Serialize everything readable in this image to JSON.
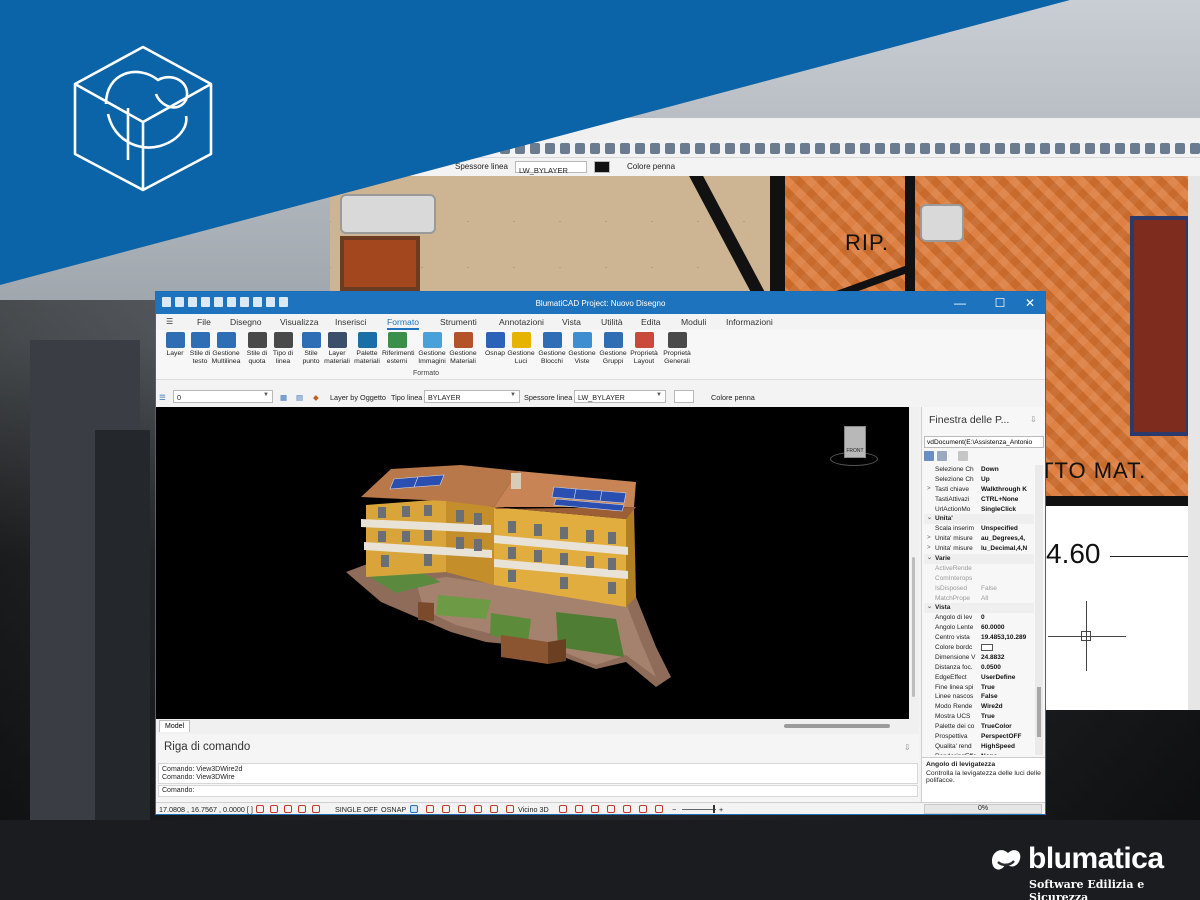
{
  "main_window": {
    "title": "BlumatiCAD Project: Nuovo Disegno",
    "controls": {
      "minimize": "—",
      "maximize": "☐",
      "close": "✕"
    }
  },
  "menu": {
    "items": [
      "File",
      "Disegno",
      "Visualizza",
      "Inserisci",
      "Formato",
      "Strumenti",
      "Annotazioni",
      "Vista",
      "Utilità",
      "Edita",
      "Moduli",
      "Informazioni"
    ],
    "active": "Formato"
  },
  "ribbon": {
    "group_label": "Formato",
    "buttons": [
      {
        "line1": "Layer",
        "line2": "",
        "icon": "layers-icon",
        "color": "#2f6db5"
      },
      {
        "line1": "Stile di",
        "line2": "testo",
        "icon": "text-style-icon",
        "color": "#2f6db5"
      },
      {
        "line1": "Gestione",
        "line2": "Multilinea",
        "icon": "multiline-icon",
        "color": "#2f6db5"
      },
      {
        "line1": "Stile di",
        "line2": "quota",
        "icon": "dimension-style-icon",
        "color": "#4a4a4a"
      },
      {
        "line1": "Tipo di",
        "line2": "linea",
        "icon": "linetype-icon",
        "color": "#4a4a4a"
      },
      {
        "line1": "Stile",
        "line2": "punto",
        "icon": "point-style-icon",
        "color": "#2f6db5"
      },
      {
        "line1": "Layer",
        "line2": "materiali",
        "icon": "layer-materials-icon",
        "color": "#3b4f6b"
      },
      {
        "line1": "Palette",
        "line2": "materiali",
        "icon": "palette-icon",
        "color": "#1b6fa8"
      },
      {
        "line1": "Riferimenti",
        "line2": "esterni",
        "icon": "xref-icon",
        "color": "#3a8f4a"
      },
      {
        "line1": "Gestione",
        "line2": "Immagini",
        "icon": "image-icon",
        "color": "#4aa0d8"
      },
      {
        "line1": "Gestione",
        "line2": "Materiali",
        "icon": "materials-icon",
        "color": "#b4532a"
      },
      {
        "line1": "Osnap",
        "line2": "",
        "icon": "magnet-icon",
        "color": "#2b63b8"
      },
      {
        "line1": "Gestione",
        "line2": "Luci",
        "icon": "bulb-icon",
        "color": "#e6b400"
      },
      {
        "line1": "Gestione",
        "line2": "Blocchi",
        "icon": "blocks-icon",
        "color": "#2f6db5"
      },
      {
        "line1": "Gestione",
        "line2": "Viste",
        "icon": "views-icon",
        "color": "#3f8fd0"
      },
      {
        "line1": "Gestione",
        "line2": "Gruppi",
        "icon": "groups-icon",
        "color": "#2f6db5"
      },
      {
        "line1": "Proprietà",
        "line2": "Layout",
        "icon": "layout-icon",
        "color": "#c94a3b"
      },
      {
        "line1": "Proprietà",
        "line2": "Generali",
        "icon": "general-props-icon",
        "color": "#4a4a4a"
      }
    ]
  },
  "propbar": {
    "layer_value": "0",
    "layer_by_object": "Layer by Oggetto",
    "linetype_label": "Tipo linea",
    "linetype_value": "BYLAYER",
    "lineweight_label": "Spessore linea",
    "lineweight_value": "LW_BYLAYER",
    "pen_color_label": "Colore penna"
  },
  "viewport": {
    "viewcube_label": "FRONT",
    "tab_label": "Model"
  },
  "command": {
    "title": "Riga di comando",
    "history": [
      "Comando: View3DWire2d",
      "Comando: View3DWire"
    ],
    "prompt": "Comando:"
  },
  "status": {
    "coords": "17.0808 , 16.7567 , 0.0000 [ ]",
    "single_off": "SINGLE OFF",
    "osnap": "OSNAP",
    "vicino3d": "Vicino 3D",
    "progress": "0%",
    "progress_fraction": 0,
    "zoom_fraction": 0.9
  },
  "properties": {
    "title": "Finestra delle P...",
    "pin": "⇩",
    "document": "vdDocument(E:\\Assistenza_Antonio",
    "rows": [
      {
        "t": "p",
        "k": "Selezione Ch",
        "v": "Down"
      },
      {
        "t": "p",
        "k": "Selezione Ch",
        "v": "Up"
      },
      {
        "t": "p",
        "k": "Tasti chiave",
        "v": "Walkthrough K",
        "x": ">"
      },
      {
        "t": "p",
        "k": "TastiAttivazi",
        "v": "CTRL+None"
      },
      {
        "t": "p",
        "k": "UrlActionMo",
        "v": "SingleClick"
      },
      {
        "t": "c",
        "k": "Unita'",
        "x": "⌄"
      },
      {
        "t": "p",
        "k": "Scala inserim",
        "v": "Unspecified"
      },
      {
        "t": "p",
        "k": "Unita' misure",
        "v": "au_Degrees,4,",
        "x": ">"
      },
      {
        "t": "p",
        "k": "Unita' misure",
        "v": "lu_Decimal,4,N",
        "x": ">"
      },
      {
        "t": "c",
        "k": "Varie",
        "x": "⌄"
      },
      {
        "t": "d",
        "k": "ActiveRende",
        "v": ""
      },
      {
        "t": "d",
        "k": "ComInterops",
        "v": ""
      },
      {
        "t": "d",
        "k": "IsDisposed",
        "v": "False"
      },
      {
        "t": "d",
        "k": "MatchPrope",
        "v": "All"
      },
      {
        "t": "c",
        "k": "Vista",
        "x": "⌄"
      },
      {
        "t": "p",
        "k": "Angolo di lev",
        "v": "0"
      },
      {
        "t": "p",
        "k": "Angolo Lente",
        "v": "60.0000"
      },
      {
        "t": "p",
        "k": "Centro vista",
        "v": "19.4853,10.289"
      },
      {
        "t": "s",
        "k": "Colore bordc",
        "v": ""
      },
      {
        "t": "p",
        "k": "Dimensione V",
        "v": "24.8832"
      },
      {
        "t": "p",
        "k": "Distanza foc.",
        "v": "0.0500"
      },
      {
        "t": "p",
        "k": "EdgeEffect",
        "v": "UserDefine"
      },
      {
        "t": "p",
        "k": "Fine linea spi",
        "v": "True"
      },
      {
        "t": "p",
        "k": "Linee nascos",
        "v": "False"
      },
      {
        "t": "p",
        "k": "Modo Rende",
        "v": "Wire2d"
      },
      {
        "t": "p",
        "k": "Mostra UCS",
        "v": "True"
      },
      {
        "t": "p",
        "k": "Palette dei co",
        "v": "TrueColor"
      },
      {
        "t": "p",
        "k": "Prospettiva",
        "v": "PerspectOFF"
      },
      {
        "t": "p",
        "k": "Qualita' rend",
        "v": "HighSpeed"
      },
      {
        "t": "p",
        "k": "RenderingEffe",
        "v": "None"
      }
    ],
    "desc_title": "Angolo di levigatezza",
    "desc_text": "Controlla la levigatezza delle luci delle polifacce."
  },
  "back_window": {
    "lineweight_label": "Spessore linea",
    "lineweight_value": "LW_BYLAYER",
    "pen_color_label": "Colore penna",
    "room_rip": "RIP.",
    "room_mat": "TTO MAT.",
    "dimension": "4.60"
  },
  "brand": {
    "name": "blumatica",
    "tagline": "Software Edilizia e Sicurezza"
  },
  "colors": {
    "accent": "#1e73be",
    "blue_band": "#0b63a8",
    "wood": "#d97330"
  }
}
